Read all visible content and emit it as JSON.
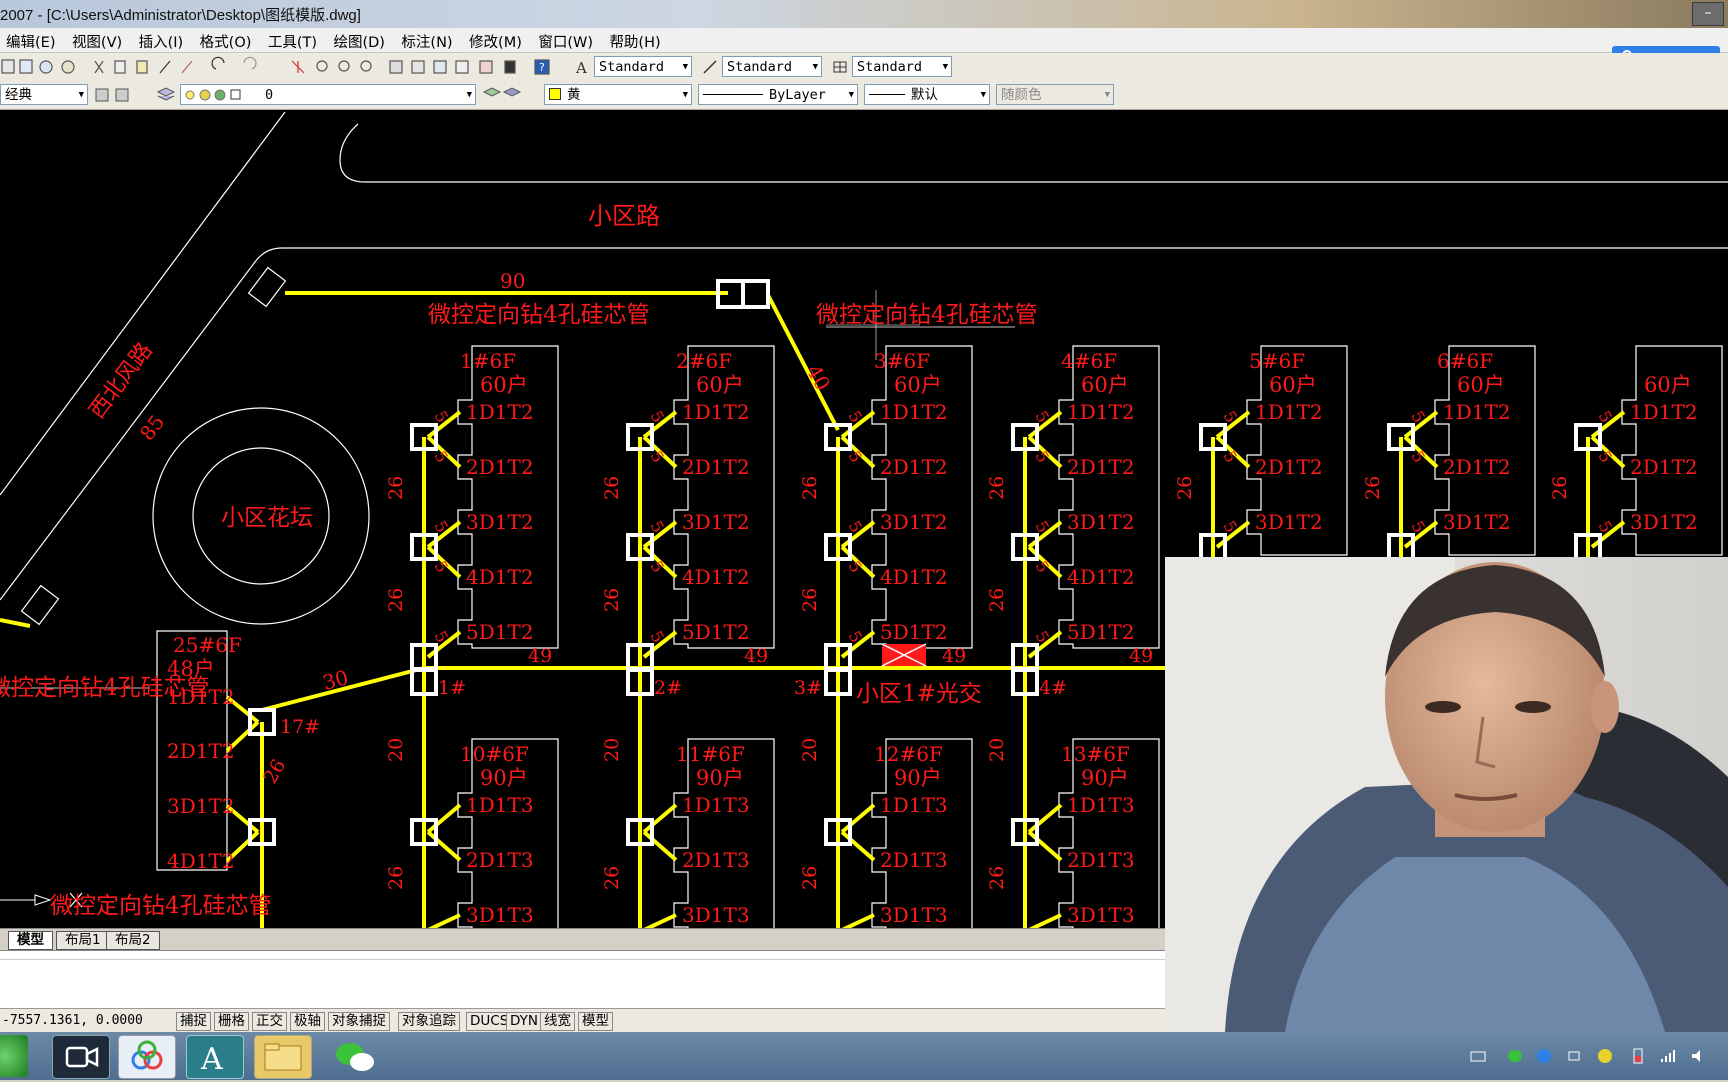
{
  "window": {
    "title": "2007 - [C:\\Users\\Administrator\\Desktop\\图纸模版.dwg]"
  },
  "menu": [
    "编辑(E)",
    "视图(V)",
    "插入(I)",
    "格式(O)",
    "工具(T)",
    "绘图(D)",
    "标注(N)",
    "修改(M)",
    "窗口(W)",
    "帮助(H)"
  ],
  "styles": {
    "text_style": "Standard",
    "dim_style": "Standard",
    "table_style": "Standard"
  },
  "layers": {
    "workspace": "经典",
    "current_layer": "0",
    "color": "黄",
    "linetype": "ByLayer",
    "lineweight": "默认",
    "plotstyle": "随颜色"
  },
  "drawing": {
    "road_top": "小区路",
    "road_left": "西北风路",
    "road_left_len": "85",
    "garden": "小区花坛",
    "pipe_label": "微控定向钻4孔硅芯管",
    "pipe_len_top": "90",
    "pipe_len_diag": "40",
    "pipe_len_diag2": "30",
    "switch_label": "小区1#光交",
    "buildings_top": [
      {
        "name": "1#6F",
        "households": "60户",
        "units": [
          "1D1T2",
          "2D1T2",
          "3D1T2",
          "4D1T2",
          "5D1T2"
        ],
        "node": "1#"
      },
      {
        "name": "2#6F",
        "households": "60户",
        "units": [
          "1D1T2",
          "2D1T2",
          "3D1T2",
          "4D1T2",
          "5D1T2"
        ],
        "node": "2#"
      },
      {
        "name": "3#6F",
        "households": "60户",
        "units": [
          "1D1T2",
          "2D1T2",
          "3D1T2",
          "4D1T2",
          "5D1T2"
        ],
        "node": "3#"
      },
      {
        "name": "4#6F",
        "households": "60户",
        "units": [
          "1D1T2",
          "2D1T2",
          "3D1T2",
          "4D1T2",
          "5D1T2"
        ],
        "node": "4#"
      },
      {
        "name": "5#6F",
        "households": "60户",
        "units": [
          "1D1T2",
          "2D1T2",
          "3D1T2"
        ],
        "node": ""
      },
      {
        "name": "6#6F",
        "households": "60户",
        "units": [
          "1D1T2",
          "2D1T2",
          "3D1T2"
        ],
        "node": ""
      },
      {
        "name": "",
        "households": "60户",
        "units": [
          "1D1T2",
          "2D1T2",
          "3D1T2"
        ],
        "node": ""
      }
    ],
    "buildings_bottom": [
      {
        "name": "10#6F",
        "households": "90户",
        "units": [
          "1D1T3",
          "2D1T3",
          "3D1T3"
        ]
      },
      {
        "name": "11#6F",
        "households": "90户",
        "units": [
          "1D1T3",
          "2D1T3",
          "3D1T3"
        ]
      },
      {
        "name": "12#6F",
        "households": "90户",
        "units": [
          "1D1T3",
          "2D1T3",
          "3D1T3"
        ]
      },
      {
        "name": "13#6F",
        "households": "90户",
        "units": [
          "1D1T3",
          "2D1T3",
          "3D1T3"
        ]
      }
    ],
    "building_left": {
      "name": "25#6F",
      "households": "48户",
      "units": [
        "1D1T2",
        "2D1T2",
        "3D1T2",
        "4D1T2"
      ],
      "node": "17#"
    },
    "seg_26": "26",
    "seg_20": "20",
    "seg_49": "49",
    "seg_5": "5"
  },
  "tabs": [
    "模型",
    "布局1",
    "布局2"
  ],
  "status": {
    "coords": "-7557.1361, 0.0000",
    "toggles": [
      "捕捉",
      "栅格",
      "正交",
      "极轴",
      "对象捕捉",
      "对象追踪",
      "DUCS",
      "DYN",
      "线宽",
      "模型"
    ]
  },
  "colors": {
    "canvas": "#000000",
    "cad_red": "#ff1a1a",
    "cad_yellow": "#ffff00",
    "cad_white": "#ffffff"
  }
}
